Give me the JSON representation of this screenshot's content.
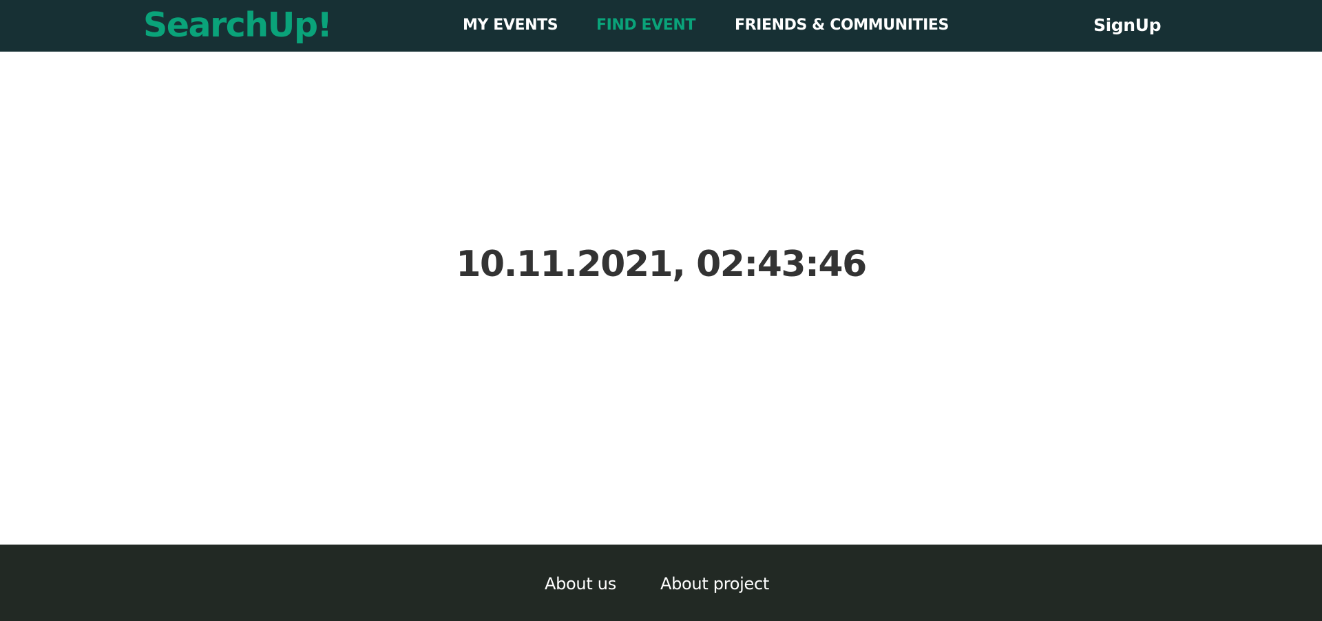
{
  "header": {
    "logo": "SearchUp!",
    "nav": {
      "my_events": "MY EVENTS",
      "find_event": "FIND EVENT",
      "friends_communities": "FRIENDS & COMMUNITIES"
    },
    "signup": "SignUp"
  },
  "main": {
    "datetime": "10.11.2021, 02:43:46"
  },
  "footer": {
    "about_us": "About us",
    "about_project": "About project"
  },
  "colors": {
    "header_bg": "#173034",
    "accent": "#0aa37a",
    "footer_bg": "#222924",
    "text_dark": "#333333"
  }
}
